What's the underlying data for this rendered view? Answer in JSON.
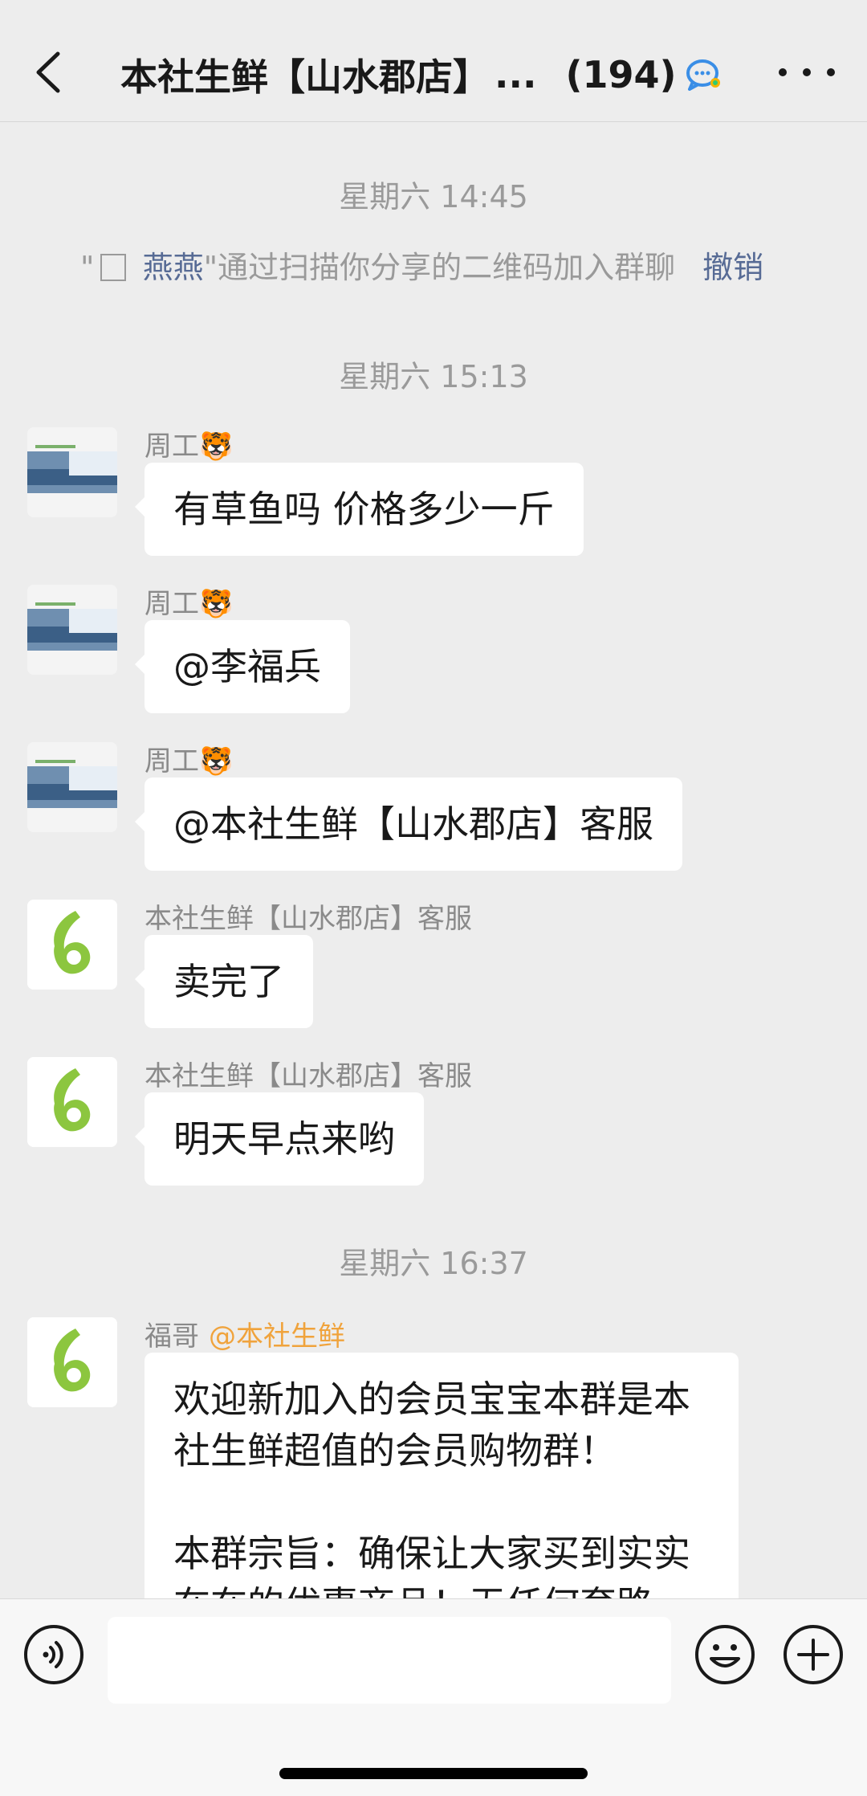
{
  "header": {
    "title": "本社生鲜【山水郡店】",
    "ellipsis": "...",
    "member_count": "(194)"
  },
  "system_notice": {
    "quote_open": "\"",
    "name": "燕燕",
    "text": "\"通过扫描你分享的二维码加入群聊",
    "revoke": "撤销"
  },
  "timestamps": [
    "星期六 14:45",
    "星期六 15:13",
    "星期六 16:37"
  ],
  "messages": [
    {
      "sender": "周工",
      "sender_emoji": "🐯",
      "text": "有草鱼吗 价格多少一斤"
    },
    {
      "sender": "周工",
      "sender_emoji": "🐯",
      "text": "@李福兵"
    },
    {
      "sender": "周工",
      "sender_emoji": "🐯",
      "text": "@本社生鲜【山水郡店】客服"
    },
    {
      "sender": "本社生鲜【山水郡店】客服",
      "text": "卖完了"
    },
    {
      "sender": "本社生鲜【山水郡店】客服",
      "text": "明天早点来哟"
    },
    {
      "sender": "福哥",
      "mention": "@本社生鲜",
      "lines": [
        "欢迎新加入的会员宝宝本群是本",
        "社生鲜超值的会员购物群！",
        "",
        "本群宗旨：确保让大家买到实实",
        "在在的优惠商品！无任何套路"
      ]
    }
  ],
  "input": {
    "placeholder": ""
  },
  "colors": {
    "accent": "#576b95",
    "mention": "#f0a33c",
    "logo_green": "#8cc63f"
  }
}
